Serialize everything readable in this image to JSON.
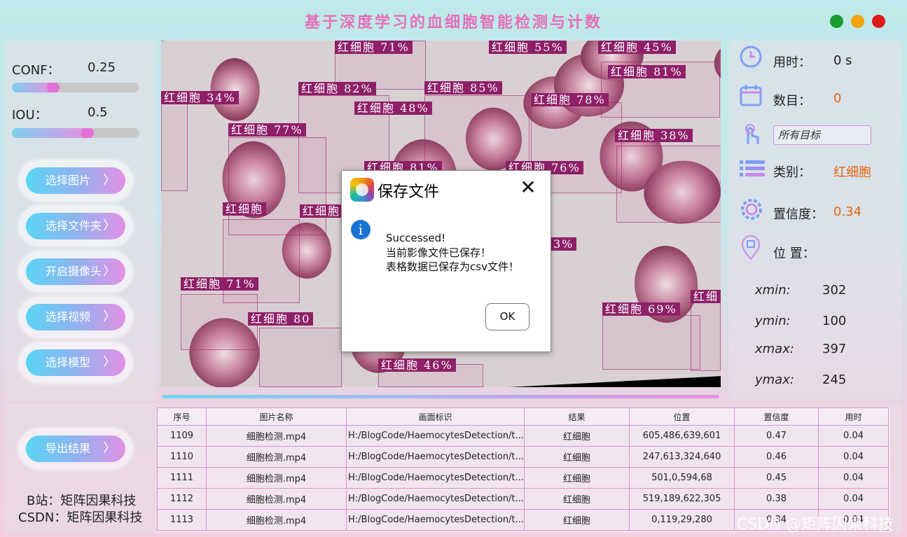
{
  "app": {
    "title": "基于深度学习的血细胞智能检测与计数",
    "window_buttons": [
      {
        "name": "close",
        "color": "#1a9c2a"
      },
      {
        "name": "minimize",
        "color": "#f2a40f"
      },
      {
        "name": "maximize",
        "color": "#e01b1b"
      }
    ]
  },
  "params": {
    "conf_label": "CONF：",
    "conf_value": "0.25",
    "conf_level": 0.25,
    "iou_label": "IOU：",
    "iou_value": "0.5",
    "iou_level": 0.5
  },
  "buttons": {
    "select_image": "选择图片",
    "select_folder": "选择文件夹",
    "open_camera": "开启摄像头",
    "select_video": "选择视频",
    "select_model": "选择模型",
    "export": "导出结果"
  },
  "detections": [
    {
      "label": "红细胞 71%"
    },
    {
      "label": "红细胞 55%"
    },
    {
      "label": "红细胞 45%"
    },
    {
      "label": "红细胞 81%"
    },
    {
      "label": "红细胞 34%"
    },
    {
      "label": "红细胞 82%"
    },
    {
      "label": "红细胞 85%"
    },
    {
      "label": "红细胞 48%"
    },
    {
      "label": "红细胞 78%"
    },
    {
      "label": "红细胞 77%"
    },
    {
      "label": "红细胞 38%"
    },
    {
      "label": "红细胞 81%"
    },
    {
      "label": "红细胞 76%"
    },
    {
      "label": "红细胞"
    },
    {
      "label": "红细胞"
    },
    {
      "label": "红细胞 71%"
    },
    {
      "label": "红细胞 80"
    },
    {
      "label": "红细胞 69%"
    },
    {
      "label": "红细"
    },
    {
      "label": "红细胞 46%"
    },
    {
      "label": "3%"
    }
  ],
  "info": {
    "time_label": "用时：",
    "time_value": "0 s",
    "count_label": "数目：",
    "count_value": "0",
    "target_select": "所有目标",
    "class_label": "类别：",
    "class_value": "红细胞",
    "conf_label": "置信度：",
    "conf_value": "0.34",
    "position_label": "位 置：",
    "xmin_label": "xmin:",
    "xmin": "302",
    "ymin_label": "ymin:",
    "ymin": "100",
    "xmax_label": "xmax:",
    "xmax": "397",
    "ymax_label": "ymax:",
    "ymax": "245",
    "accent_color": "#e8620e"
  },
  "table": {
    "headers": [
      "序号",
      "图片名称",
      "画面标识",
      "结果",
      "位置",
      "置信度",
      "用时"
    ],
    "rows": [
      [
        "1109",
        "细胞检测.mp4",
        "H:/BlogCode/HaemocytesDetection/t...",
        "红细胞",
        "605,486,639,601",
        "0.47",
        "0.04"
      ],
      [
        "1110",
        "细胞检测.mp4",
        "H:/BlogCode/HaemocytesDetection/t...",
        "红细胞",
        "247,613,324,640",
        "0.46",
        "0.04"
      ],
      [
        "1111",
        "细胞检测.mp4",
        "H:/BlogCode/HaemocytesDetection/t...",
        "红细胞",
        "501,0,594,68",
        "0.45",
        "0.04"
      ],
      [
        "1112",
        "细胞检测.mp4",
        "H:/BlogCode/HaemocytesDetection/t...",
        "红细胞",
        "519,189,622,305",
        "0.38",
        "0.04"
      ],
      [
        "1113",
        "细胞检测.mp4",
        "H:/BlogCode/HaemocytesDetection/t...",
        "红细胞",
        "0,119,29,280",
        "0.34",
        "0.04"
      ]
    ]
  },
  "credits": {
    "bilibili": "B站：矩阵因果科技",
    "csdn": "CSDN：矩阵因果科技"
  },
  "watermark": "CSDN @矩阵因果科技",
  "dialog": {
    "title": "保存文件",
    "close": "✕",
    "info_glyph": "i",
    "line1": "Successed!",
    "line2": "当前影像文件已保存！",
    "line3": "表格数据已保存为csv文件！",
    "ok": "OK"
  }
}
